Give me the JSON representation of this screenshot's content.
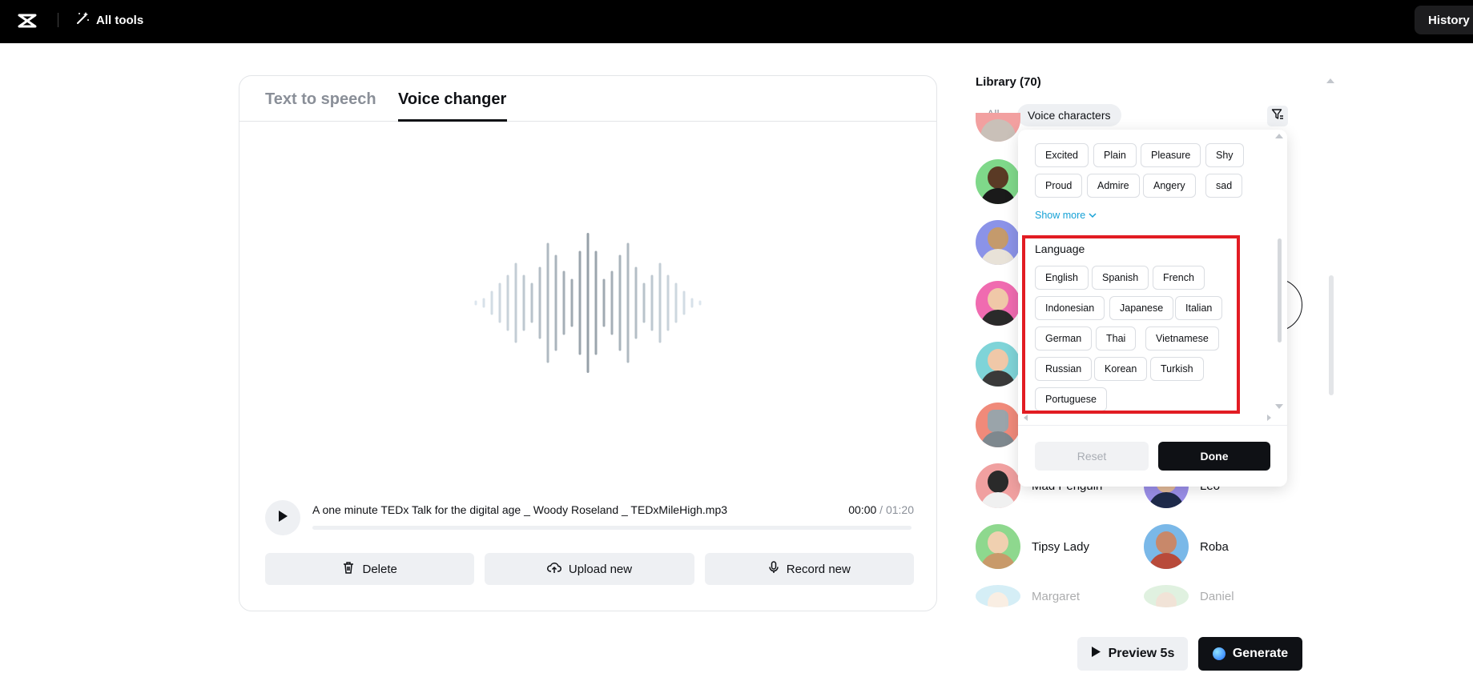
{
  "topbar": {
    "logo_icon": "capcut-logo-icon",
    "all_tools_label": "All tools",
    "history_label": "History"
  },
  "editor": {
    "tabs": [
      {
        "label": "Text to speech",
        "active": false
      },
      {
        "label": "Voice changer",
        "active": true
      }
    ],
    "player": {
      "filename": "A one minute TEDx Talk for the digital age _ Woody Roseland _ TEDxMileHigh.mp3",
      "current_time": "00:00",
      "separator": " / ",
      "total_time": "01:20",
      "progress": 0
    },
    "actions": {
      "delete_label": "Delete",
      "upload_label": "Upload new",
      "record_label": "Record new"
    }
  },
  "library": {
    "title": "Library (70)",
    "filter_all": "All",
    "filter_active": "Voice characters",
    "voices": [
      {
        "name": "Mad Penguin"
      },
      {
        "name": "Leo"
      },
      {
        "name": "Tipsy Lady"
      },
      {
        "name": "Roba"
      },
      {
        "name": "Margaret"
      },
      {
        "name": "Daniel"
      }
    ]
  },
  "filter_popup": {
    "emotion_tags": [
      "Excited",
      "Plain",
      "Pleasure",
      "Shy",
      "Proud",
      "Admire",
      "Angery",
      "sad"
    ],
    "show_more": "Show more",
    "language_title": "Language",
    "languages": [
      "English",
      "Spanish",
      "French",
      "Indonesian",
      "Japanese",
      "Italian",
      "German",
      "Thai",
      "Vietnamese",
      "Russian",
      "Korean",
      "Turkish",
      "Portuguese"
    ],
    "reset_label": "Reset",
    "done_label": "Done"
  },
  "footer": {
    "preview_label": "Preview 5s",
    "generate_label": "Generate"
  },
  "colors": {
    "accent_link": "#15a1d6",
    "highlight_border": "#e21c23",
    "primary_dark": "#0f1115"
  }
}
